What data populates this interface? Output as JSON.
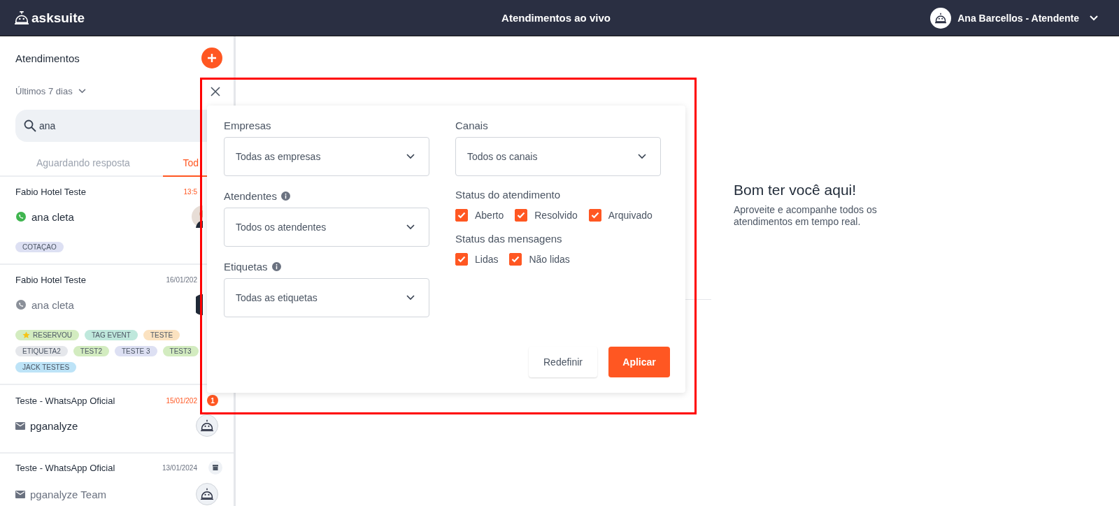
{
  "header": {
    "logo": "asksuite",
    "title": "Atendimentos ao vivo",
    "user": "Ana Barcellos - Atendente"
  },
  "sidebar": {
    "title": "Atendimentos",
    "period": "Últimos 7 dias",
    "search": {
      "value": "ana"
    },
    "tabs": [
      {
        "label": "Aguardando resposta",
        "selected": false
      },
      {
        "label": "Tod",
        "selected": true
      }
    ],
    "conversations": [
      {
        "company": "Fabio Hotel Teste",
        "time": "13:5",
        "unread": true,
        "channel": {
          "kind": "whatsapp"
        },
        "contact": "ana cleta",
        "avatar": {
          "kind": "photo"
        },
        "tags": [
          {
            "label": "COTAÇAO",
            "color": "#dde0f3",
            "star": false
          }
        ]
      },
      {
        "company": "Fabio Hotel Teste",
        "time": "16/01/202",
        "unread": false,
        "channel": {
          "kind": "whatsapp"
        },
        "contact": "ana cleta",
        "avatar": {
          "kind": "dark"
        },
        "tags": [
          {
            "label": "RESERVOU",
            "color": "#d3ecc0",
            "star": true
          },
          {
            "label": "TAG EVENT",
            "color": "#bfe8dc",
            "star": false
          },
          {
            "label": "TESTE",
            "color": "#fbe2c0",
            "star": false
          },
          {
            "label": "ETIQUETA2",
            "color": "#e5e7eb",
            "star": false
          },
          {
            "label": "TEST2",
            "color": "#d3ecc0",
            "star": false
          },
          {
            "label": "TESTE 3",
            "color": "#dde0f3",
            "star": false
          },
          {
            "label": "TEST3",
            "color": "#d3ecc0",
            "star": false
          },
          {
            "label": "JACK TESTES",
            "color": "#bde3f7",
            "star": false
          }
        ]
      },
      {
        "company": "Teste - WhatsApp Oficial",
        "time": "15/01/202",
        "unread": true,
        "badge": "1",
        "channel": {
          "kind": "email"
        },
        "contact": "pganalyze",
        "avatar": {
          "kind": "bot"
        }
      },
      {
        "company": "Teste - WhatsApp Oficial",
        "time": "13/01/2024",
        "unread": false,
        "archived": true,
        "channel": {
          "kind": "email"
        },
        "contact": "pganalyze Team",
        "avatar": {
          "kind": "bot"
        }
      }
    ]
  },
  "filters": {
    "selects": [
      {
        "label": "Empresas",
        "info": false,
        "value": "Todas as empresas"
      },
      {
        "label": "Atendentes",
        "info": true,
        "value": "Todos os atendentes"
      },
      {
        "label": "Etiquetas",
        "info": true,
        "value": "Todas as etiquetas"
      }
    ],
    "channels": {
      "label": "Canais",
      "value": "Todos os canais"
    },
    "groups": [
      {
        "title": "Status do atendimento",
        "options": [
          {
            "label": "Aberto",
            "checked": true
          },
          {
            "label": "Resolvido",
            "checked": true
          },
          {
            "label": "Arquivado",
            "checked": true
          }
        ]
      },
      {
        "title": "Status das mensagens",
        "options": [
          {
            "label": "Lidas",
            "checked": true
          },
          {
            "label": "Não lidas",
            "checked": true
          }
        ]
      }
    ],
    "buttons": {
      "reset": "Redefinir",
      "apply": "Aplicar"
    }
  },
  "welcome": {
    "title": "Bom ter você aqui!",
    "text": "Aproveite e acompanhe todos os atendimentos em tempo real."
  }
}
